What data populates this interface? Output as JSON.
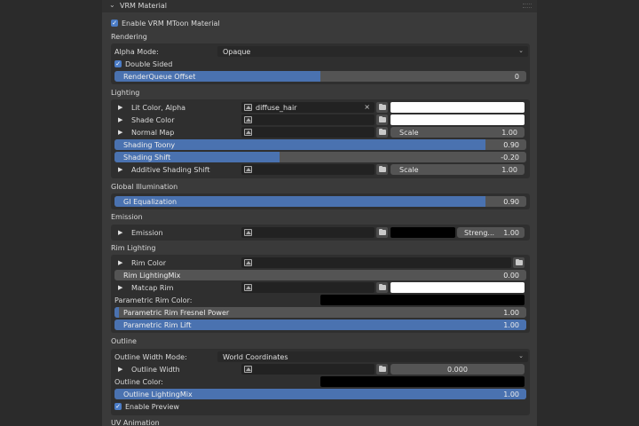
{
  "header": {
    "title": "VRM Material",
    "twirl": "⌄"
  },
  "enable_mtoon": {
    "label": "Enable VRM MToon Material",
    "checked": true
  },
  "rendering": {
    "title": "Rendering",
    "alpha_mode_label": "Alpha Mode:",
    "alpha_mode_value": "Opaque",
    "double_sided_label": "Double Sided",
    "renderqueue": {
      "label": "RenderQueue Offset",
      "value": "0",
      "fill": 0.5
    }
  },
  "lighting": {
    "title": "Lighting",
    "lit_color": {
      "label": "Lit Color, Alpha",
      "texture": "diffuse_hair",
      "clear": "×",
      "swatch": "#ffffff"
    },
    "shade_color": {
      "label": "Shade Color",
      "swatch": "#ffffff"
    },
    "normal_map": {
      "label": "Normal Map",
      "scale_label": "Scale",
      "scale_value": "1.00"
    },
    "shading_toony": {
      "label": "Shading Toony",
      "value": "0.90",
      "fill": 0.9
    },
    "shading_shift": {
      "label": "Shading Shift",
      "value": "-0.20",
      "fill": 0.4
    },
    "additive_shading_shift": {
      "label": "Additive Shading Shift",
      "scale_label": "Scale",
      "scale_value": "1.00"
    }
  },
  "gi": {
    "title": "Global Illumination",
    "equalization": {
      "label": "GI Equalization",
      "value": "0.90",
      "fill": 0.9
    }
  },
  "emission": {
    "title": "Emission",
    "label": "Emission",
    "swatch": "#000000",
    "strength_label": "Streng...",
    "strength_value": "1.00"
  },
  "rim": {
    "title": "Rim Lighting",
    "rim_color_label": "Rim Color",
    "rim_lightingmix": {
      "label": "Rim LightingMix",
      "value": "0.00",
      "fill": 0.0
    },
    "matcap_label": "Matcap Rim",
    "matcap_swatch": "#ffffff",
    "param_color_label": "Parametric Rim Color:",
    "param_color_swatch": "#000000",
    "fresnel": {
      "label": "Parametric Rim Fresnel Power",
      "value": "1.00",
      "fill": 0.01
    },
    "lift": {
      "label": "Parametric Rim Lift",
      "value": "1.00",
      "fill": 1.0
    }
  },
  "outline": {
    "title": "Outline",
    "width_mode_label": "Outline Width Mode:",
    "width_mode_value": "World Coordinates",
    "width_label": "Outline Width",
    "width_value": "0.000",
    "color_label": "Outline Color:",
    "color_swatch": "#000000",
    "lightingmix": {
      "label": "Outline LightingMix",
      "value": "1.00",
      "fill": 1.0
    },
    "enable_preview_label": "Enable Preview"
  },
  "uv": {
    "title": "UV Animation"
  },
  "glyphs": {
    "check": "✓",
    "tri": "▶",
    "arrow": "⌄"
  }
}
